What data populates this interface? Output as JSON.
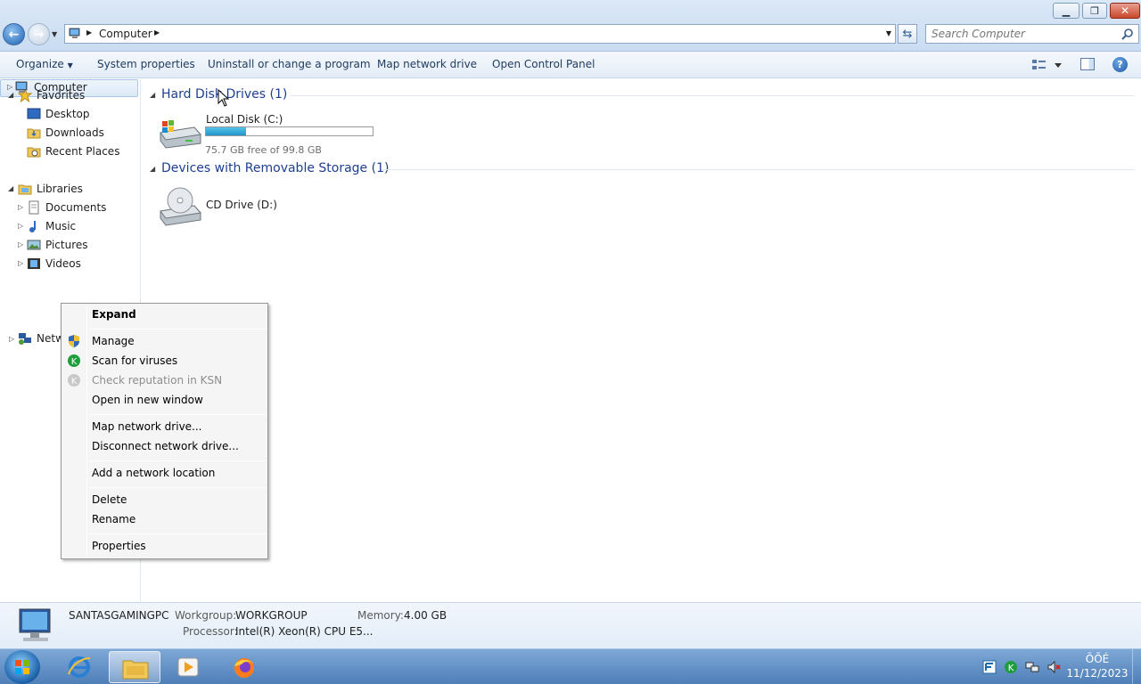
{
  "window": {
    "min_glyph": "▁",
    "max_glyph": "❐",
    "close_glyph": "✕"
  },
  "address": {
    "crumb": "Computer"
  },
  "search": {
    "placeholder": "Search Computer"
  },
  "toolbar": {
    "organize": "Organize",
    "system_properties": "System properties",
    "uninstall": "Uninstall or change a program",
    "map_network": "Map network drive",
    "control_panel": "Open Control Panel",
    "help_glyph": "?"
  },
  "nav": {
    "favorites": "Favorites",
    "desktop": "Desktop",
    "downloads": "Downloads",
    "recent": "Recent Places",
    "libraries": "Libraries",
    "documents": "Documents",
    "music": "Music",
    "pictures": "Pictures",
    "videos": "Videos",
    "computer": "Computer",
    "network": "Network"
  },
  "content": {
    "hdd_group": "Hard Disk Drives (1)",
    "local_disk_name": "Local Disk (C:)",
    "local_disk_free": "75.7 GB free of 99.8 GB",
    "local_disk_used_fraction": 0.242,
    "removable_group": "Devices with Removable Storage (1)",
    "cd_name": "CD Drive (D:)"
  },
  "context_menu": {
    "expand": "Expand",
    "manage": "Manage",
    "scan": "Scan for viruses",
    "reputation": "Check reputation in KSN",
    "open_new": "Open in new window",
    "map": "Map network drive...",
    "disconnect": "Disconnect network drive...",
    "add_location": "Add a network location",
    "delete": "Delete",
    "rename": "Rename",
    "properties": "Properties"
  },
  "details": {
    "computer_name": "SANTASGAMINGPC",
    "workgroup_label": "Workgroup:",
    "workgroup_value": "WORKGROUP",
    "memory_label": "Memory:",
    "memory_value": "4.00 GB",
    "processor_label": "Processor:",
    "processor_value": "Intel(R) Xeon(R) CPU E5..."
  },
  "taskbar": {
    "time": "ÕÕÉ",
    "date": "11/12/2023"
  },
  "colors": {
    "group_title": "#1e3f8f",
    "bar_fill": "#2495c9",
    "taskbar": "#4f7fb8"
  }
}
